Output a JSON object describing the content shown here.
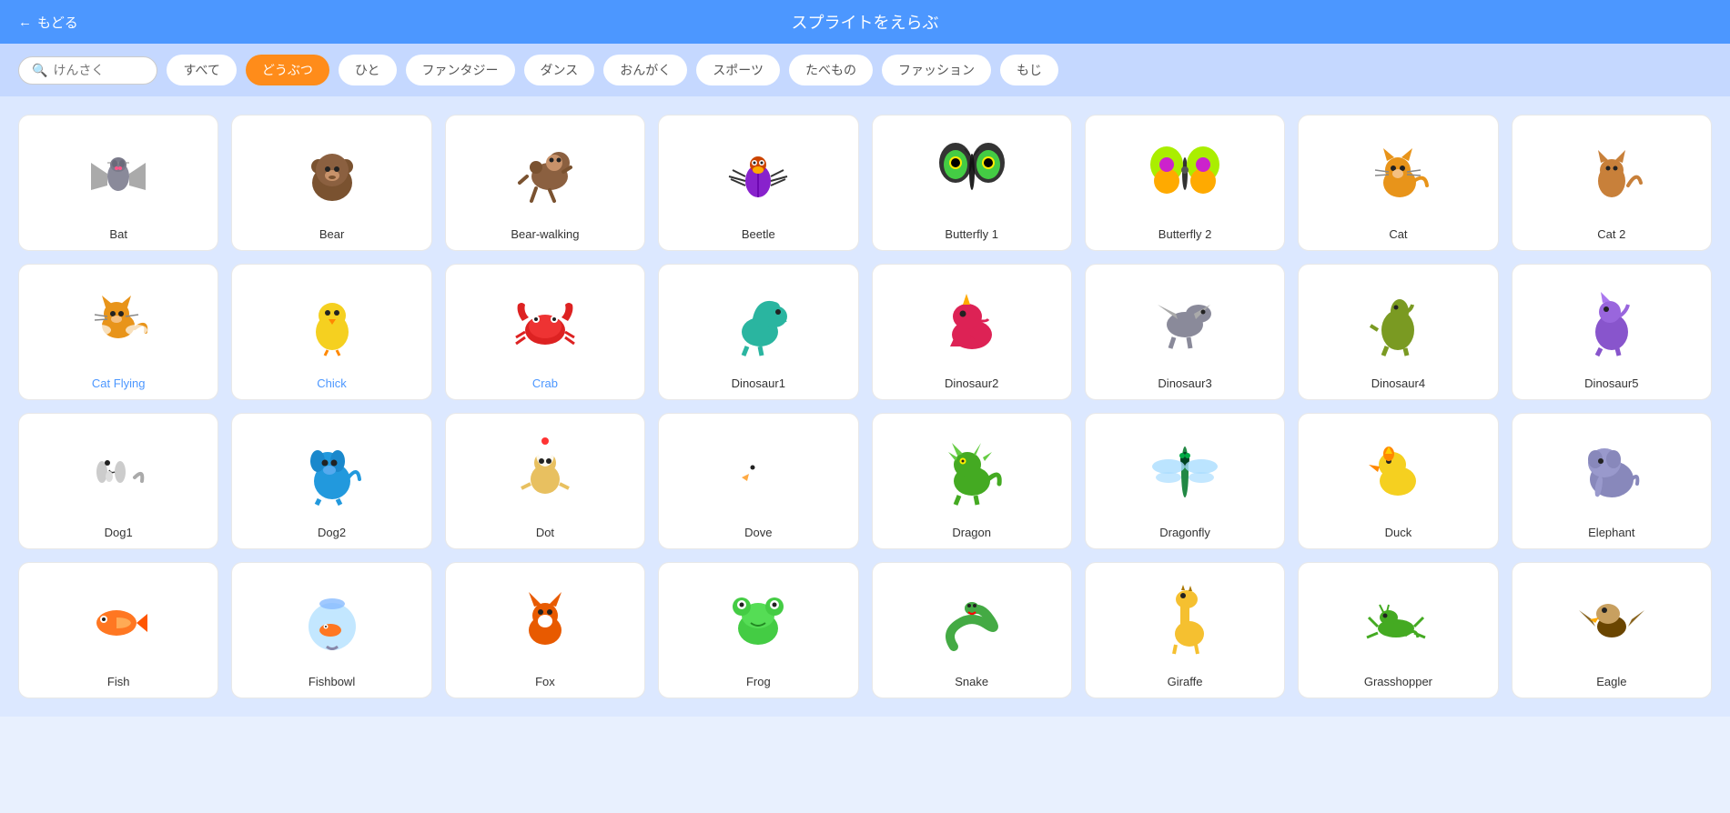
{
  "header": {
    "back_label": "もどる",
    "title": "スプライトをえらぶ"
  },
  "search": {
    "placeholder": "けんさく"
  },
  "filters": [
    {
      "id": "all",
      "label": "すべて",
      "active": false
    },
    {
      "id": "animals",
      "label": "どうぶつ",
      "active": true
    },
    {
      "id": "people",
      "label": "ひと",
      "active": false
    },
    {
      "id": "fantasy",
      "label": "ファンタジー",
      "active": false
    },
    {
      "id": "dance",
      "label": "ダンス",
      "active": false
    },
    {
      "id": "music",
      "label": "おんがく",
      "active": false
    },
    {
      "id": "sports",
      "label": "スポーツ",
      "active": false
    },
    {
      "id": "food",
      "label": "たべもの",
      "active": false
    },
    {
      "id": "fashion",
      "label": "ファッション",
      "active": false
    },
    {
      "id": "letters",
      "label": "もじ",
      "active": false
    }
  ],
  "sprites": [
    {
      "id": "bat",
      "label": "Bat",
      "emoji": "🦇",
      "blue": false
    },
    {
      "id": "bear",
      "label": "Bear",
      "emoji": "🐻",
      "blue": false
    },
    {
      "id": "bear-walking",
      "label": "Bear-walking",
      "emoji": "🐻",
      "blue": false
    },
    {
      "id": "beetle",
      "label": "Beetle",
      "emoji": "🐛",
      "blue": false
    },
    {
      "id": "butterfly1",
      "label": "Butterfly 1",
      "emoji": "🦋",
      "blue": false
    },
    {
      "id": "butterfly2",
      "label": "Butterfly 2",
      "emoji": "🦋",
      "blue": false
    },
    {
      "id": "cat",
      "label": "Cat",
      "emoji": "🐱",
      "blue": false
    },
    {
      "id": "cat2",
      "label": "Cat 2",
      "emoji": "🐹",
      "blue": false
    },
    {
      "id": "cat-flying",
      "label": "Cat Flying",
      "emoji": "🐱",
      "blue": true
    },
    {
      "id": "chick",
      "label": "Chick",
      "emoji": "🐤",
      "blue": true
    },
    {
      "id": "crab",
      "label": "Crab",
      "emoji": "🦀",
      "blue": true
    },
    {
      "id": "dinosaur1",
      "label": "Dinosaur1",
      "emoji": "🦕",
      "blue": false
    },
    {
      "id": "dinosaur2",
      "label": "Dinosaur2",
      "emoji": "🦖",
      "blue": false
    },
    {
      "id": "dinosaur3",
      "label": "Dinosaur3",
      "emoji": "🦕",
      "blue": false
    },
    {
      "id": "dinosaur4",
      "label": "Dinosaur4",
      "emoji": "🦎",
      "blue": false
    },
    {
      "id": "dinosaur5",
      "label": "Dinosaur5",
      "emoji": "🦖",
      "blue": false
    },
    {
      "id": "dog1",
      "label": "Dog1",
      "emoji": "🐕",
      "blue": false
    },
    {
      "id": "dog2",
      "label": "Dog2",
      "emoji": "🐩",
      "blue": false
    },
    {
      "id": "dot",
      "label": "Dot",
      "emoji": "🧑‍🚀",
      "blue": false
    },
    {
      "id": "dove",
      "label": "Dove",
      "emoji": "🕊️",
      "blue": false
    },
    {
      "id": "dragon",
      "label": "Dragon",
      "emoji": "🐉",
      "blue": false
    },
    {
      "id": "dragonfly",
      "label": "Dragonfly",
      "emoji": "🪲",
      "blue": false
    },
    {
      "id": "duck",
      "label": "Duck",
      "emoji": "🦆",
      "blue": false
    },
    {
      "id": "elephant",
      "label": "Elephant",
      "emoji": "🐘",
      "blue": false
    },
    {
      "id": "fish",
      "label": "Fish",
      "emoji": "🐠",
      "blue": false
    },
    {
      "id": "fishbowl",
      "label": "Fishbowl",
      "emoji": "🐡",
      "blue": false
    },
    {
      "id": "fox",
      "label": "Fox",
      "emoji": "🦊",
      "blue": false
    },
    {
      "id": "frog",
      "label": "Frog",
      "emoji": "🐸",
      "blue": false
    },
    {
      "id": "snake",
      "label": "Snake",
      "emoji": "🐍",
      "blue": false
    },
    {
      "id": "giraffe",
      "label": "Giraffe",
      "emoji": "🦒",
      "blue": false
    },
    {
      "id": "grasshopper",
      "label": "Grasshopper",
      "emoji": "🦗",
      "blue": false
    },
    {
      "id": "eagle",
      "label": "Eagle",
      "emoji": "🦅",
      "blue": false
    }
  ]
}
